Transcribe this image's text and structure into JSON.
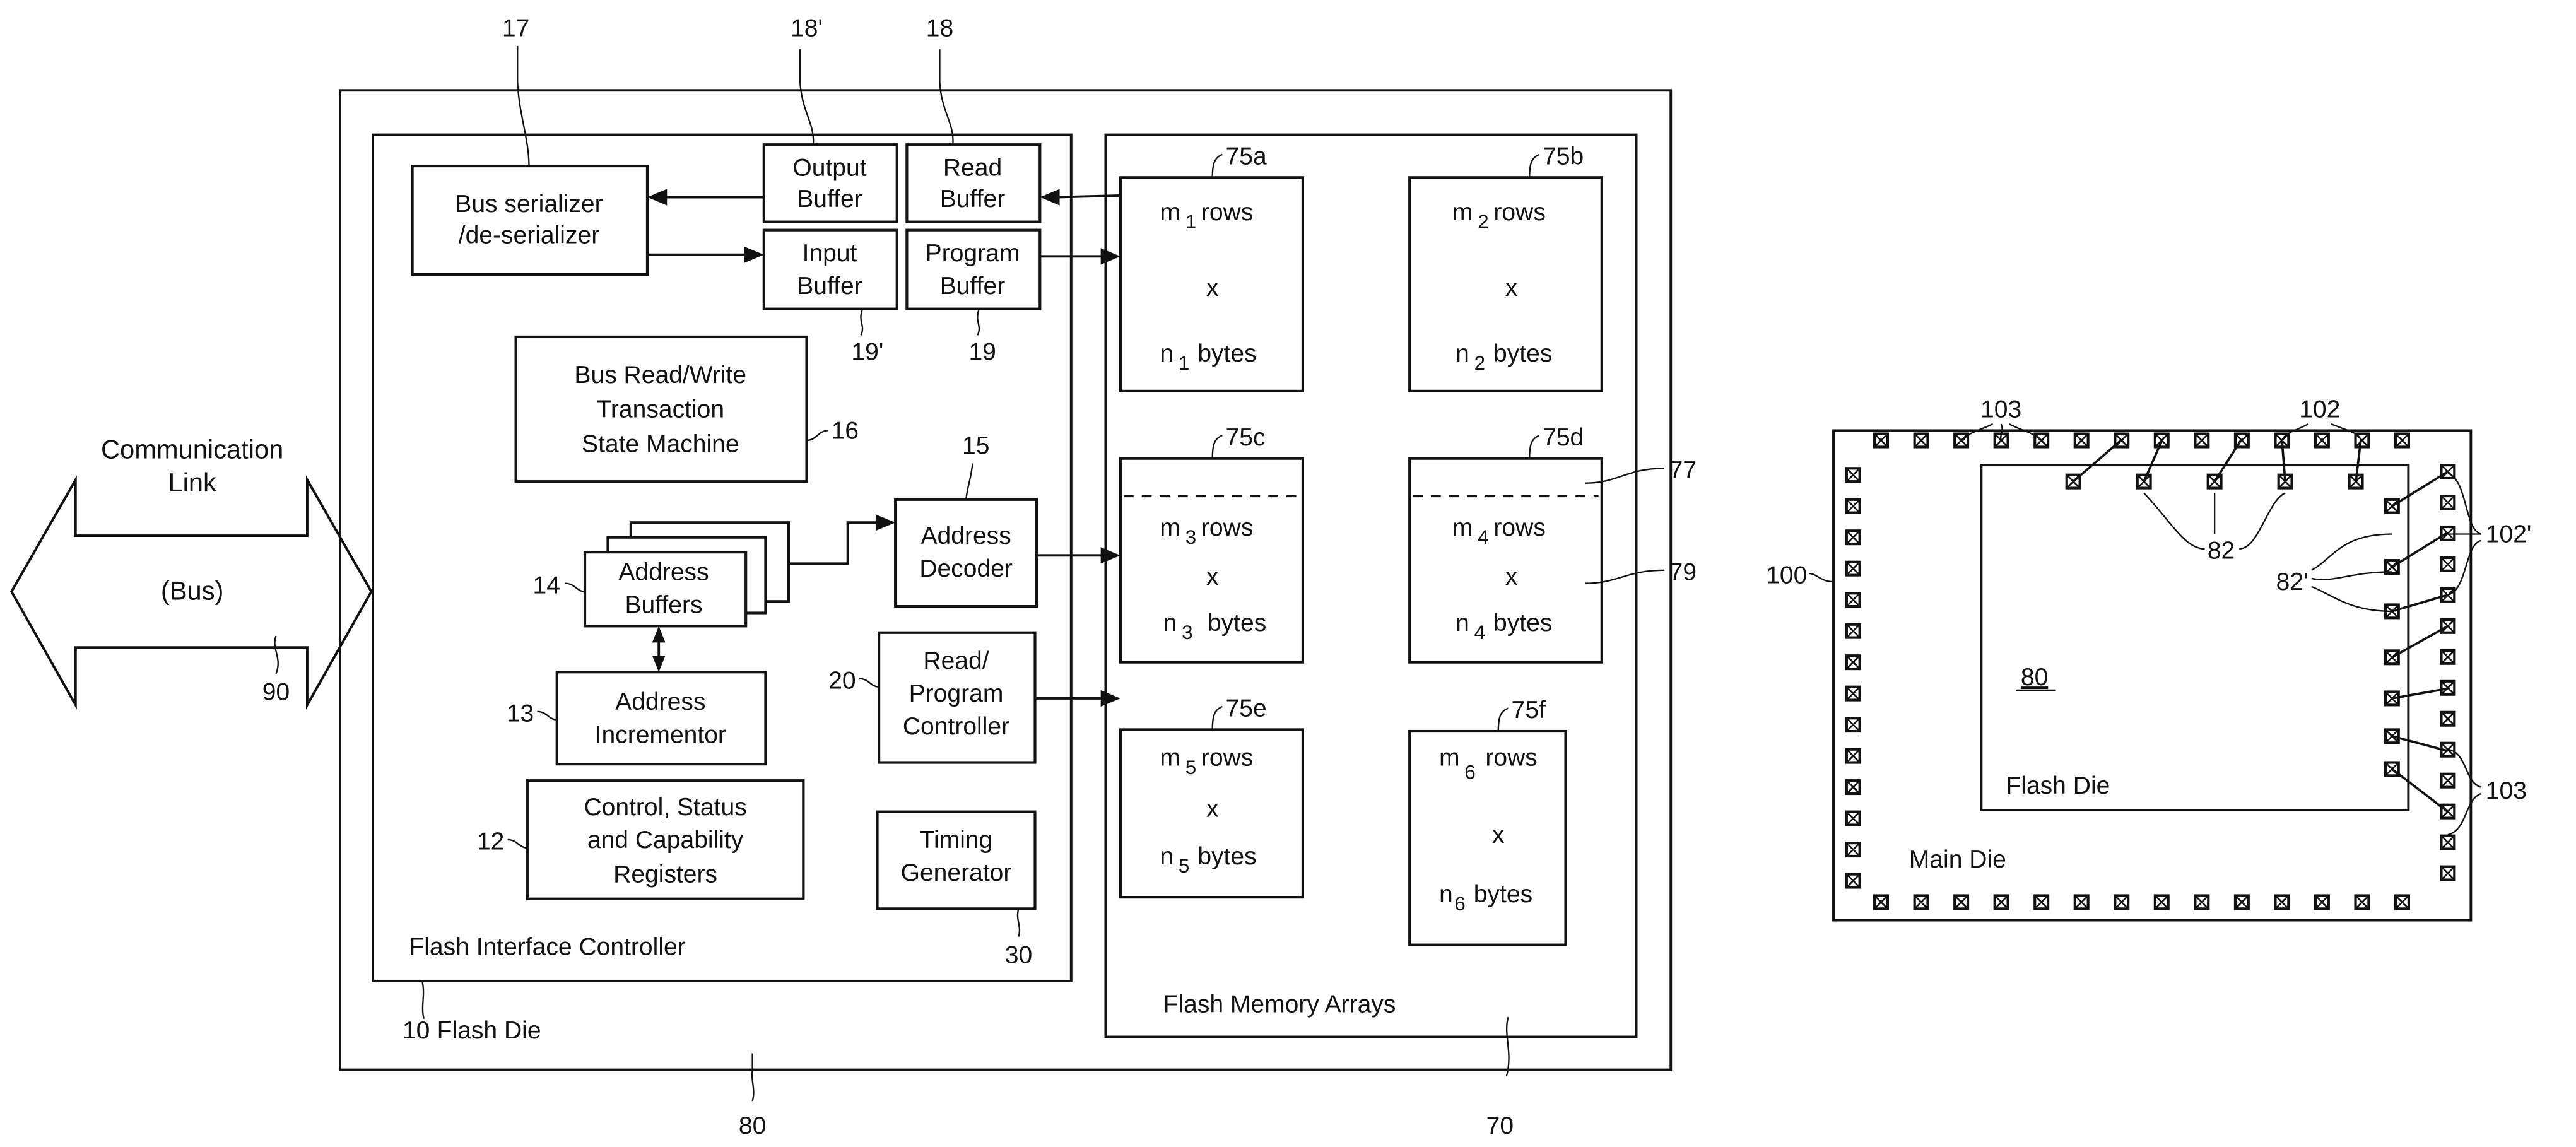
{
  "left_figure": {
    "communication_link": {
      "label_line1": "Communication",
      "label_line2": "Link",
      "bus_label": "(Bus)",
      "ref": "90"
    },
    "outer_die": {
      "ref": "80",
      "label_ref": "10",
      "label": "Flash Die"
    },
    "controller": {
      "label": "Flash Interface Controller",
      "blocks": {
        "bus_serializer": {
          "line1": "Bus serializer",
          "line2": "/de-serializer",
          "ref": "17"
        },
        "output_buffer": {
          "line1": "Output",
          "line2": "Buffer",
          "ref": "18'"
        },
        "read_buffer": {
          "line1": "Read",
          "line2": "Buffer",
          "ref": "18"
        },
        "input_buffer": {
          "line1": "Input",
          "line2": "Buffer",
          "ref": "19'"
        },
        "program_buffer": {
          "line1": "Program",
          "line2": "Buffer",
          "ref": "19"
        },
        "bus_rw": {
          "line1": "Bus Read/Write",
          "line2": "Transaction",
          "line3": "State Machine",
          "ref": "16"
        },
        "address_buffers": {
          "line1": "Address",
          "line2": "Buffers",
          "ref": "14"
        },
        "address_decoder": {
          "line1": "Address",
          "line2": "Decoder",
          "ref": "15"
        },
        "address_incrementor": {
          "line1": "Address",
          "line2": "Incrementor",
          "ref": "13"
        },
        "rp_controller": {
          "line1": "Read/",
          "line2": "Program",
          "line3": "Controller",
          "ref": "20"
        },
        "control_registers": {
          "line1": "Control, Status",
          "line2": "and  Capability",
          "line3": "Registers",
          "ref": "12"
        },
        "timing_generator": {
          "line1": "Timing",
          "line2": "Generator",
          "ref": "30"
        }
      }
    },
    "memory_arrays": {
      "label": "Flash Memory Arrays",
      "ref": "70",
      "ref_77": "77",
      "ref_79": "79",
      "arrays": [
        {
          "ref": "75a",
          "m": "m",
          "m_sub": "1",
          "rows": "rows",
          "x": "x",
          "n": "n",
          "n_sub": "1",
          "bytes": "bytes"
        },
        {
          "ref": "75b",
          "m": "m",
          "m_sub": "2",
          "rows": "rows",
          "x": "x",
          "n": "n",
          "n_sub": "2",
          "bytes": "bytes"
        },
        {
          "ref": "75c",
          "m": "m",
          "m_sub": "3",
          "rows": "rows",
          "x": "x",
          "n": "n",
          "n_sub": "3",
          "bytes": "bytes"
        },
        {
          "ref": "75d",
          "m": "m",
          "m_sub": "4",
          "rows": "rows",
          "x": "x",
          "n": "n",
          "n_sub": "4",
          "bytes": "bytes"
        },
        {
          "ref": "75e",
          "m": "m",
          "m_sub": "5",
          "rows": "rows",
          "x": "x",
          "n": "n",
          "n_sub": "5",
          "bytes": "bytes"
        },
        {
          "ref": "75f",
          "m": "m",
          "m_sub": "6",
          "rows": "rows",
          "x": "x",
          "n": "n",
          "n_sub": "6",
          "bytes": "bytes"
        }
      ]
    }
  },
  "right_figure": {
    "main_die_label": "Main Die",
    "main_die_ref": "100",
    "flash_die_label": "Flash Die",
    "flash_die_ref": "80",
    "ref_103_top": "103",
    "ref_102": "102",
    "ref_82": "82",
    "ref_82p": "82'",
    "ref_102p": "102'",
    "ref_103_right": "103"
  }
}
